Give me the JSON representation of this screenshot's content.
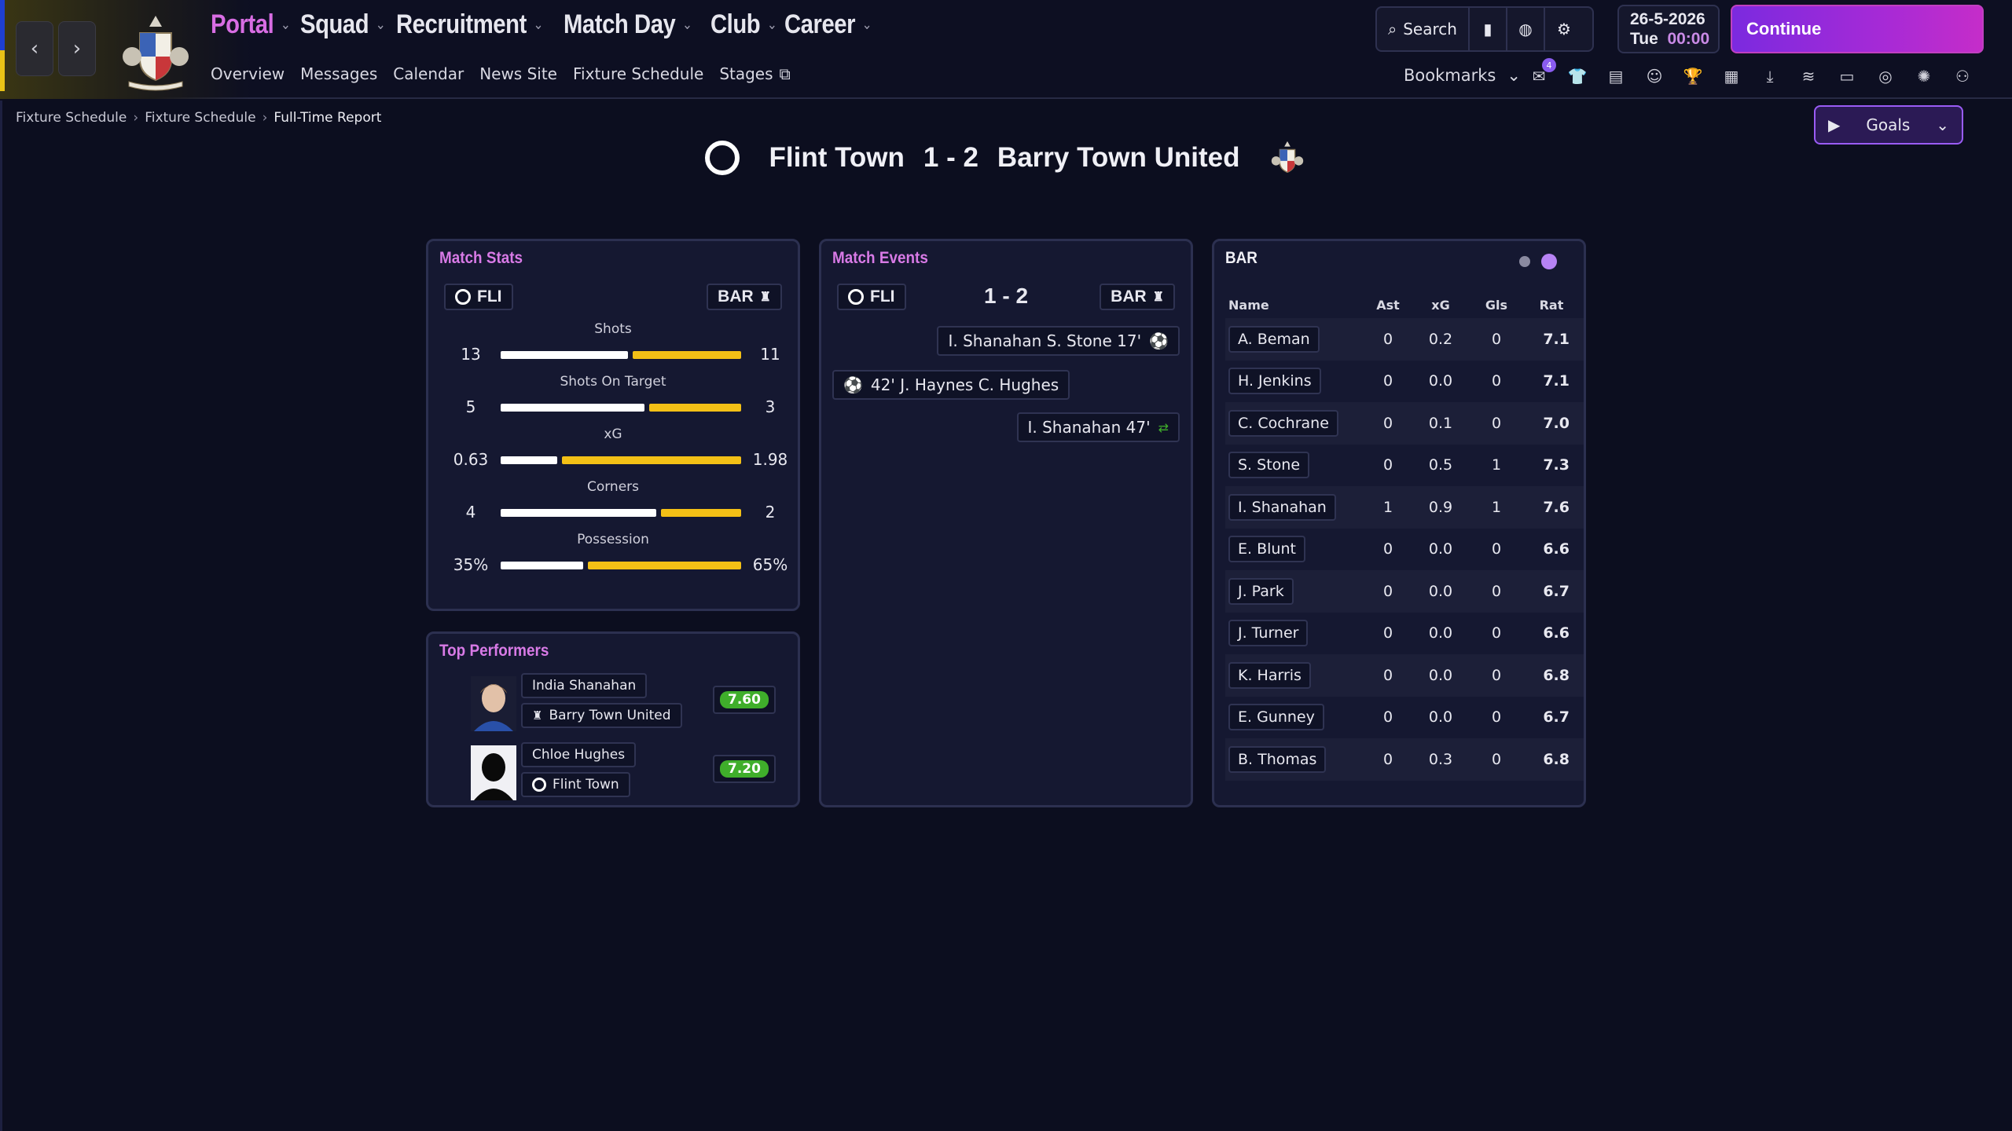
{
  "nav": {
    "back_label": "‹",
    "forward_label": "›",
    "main": [
      {
        "label": "Portal",
        "active": true
      },
      {
        "label": "Squad",
        "active": false
      },
      {
        "label": "Recruitment",
        "active": false
      },
      {
        "label": "Match Day",
        "active": false
      },
      {
        "label": "Club",
        "active": false
      },
      {
        "label": "Career",
        "active": false
      }
    ],
    "sub": [
      "Overview",
      "Messages",
      "Calendar",
      "News Site",
      "Fixture Schedule",
      "Stages"
    ],
    "search_label": "Search",
    "date": "26-5-2026",
    "day": "Tue",
    "time": "00:00",
    "continue_label": "Continue",
    "bookmarks_label": "Bookmarks",
    "inbox_badge": "4"
  },
  "breadcrumb": [
    "Fixture Schedule",
    "Fixture Schedule",
    "Full-Time Report"
  ],
  "goals_button": "Goals",
  "match": {
    "home": "Flint Town",
    "away": "Barry Town United",
    "score": "1 - 2",
    "home_abbr": "FLI",
    "away_abbr": "BAR"
  },
  "match_stats": {
    "title": "Match Stats",
    "rows": [
      {
        "label": "Shots",
        "home": "13",
        "away": "11",
        "home_share": 0.54
      },
      {
        "label": "Shots On Target",
        "home": "5",
        "away": "3",
        "home_share": 0.61
      },
      {
        "label": "xG",
        "home": "0.63",
        "away": "1.98",
        "home_share": 0.24
      },
      {
        "label": "Corners",
        "home": "4",
        "away": "2",
        "home_share": 0.66
      },
      {
        "label": "Possession",
        "home": "35%",
        "away": "65%",
        "home_share": 0.35
      }
    ]
  },
  "top_performers": {
    "title": "Top Performers",
    "players": [
      {
        "name": "India Shanahan",
        "team": "Barry Town United",
        "rating": "7.60"
      },
      {
        "name": "Chloe Hughes",
        "team": "Flint Town",
        "rating": "7.20"
      }
    ]
  },
  "match_events": {
    "title": "Match Events",
    "score": "1 - 2",
    "events": [
      {
        "text": "I. Shanahan  S. Stone 17'",
        "side": "away",
        "type": "goal"
      },
      {
        "text": "42'  J. Haynes  C. Hughes",
        "side": "home",
        "type": "goal"
      },
      {
        "text": "I. Shanahan 47'",
        "side": "away",
        "type": "substitution"
      }
    ]
  },
  "player_table": {
    "title": "BAR",
    "columns": [
      "Name",
      "Ast",
      "xG",
      "Gls",
      "Rat"
    ],
    "rows": [
      [
        "A. Beman",
        "0",
        "0.2",
        "0",
        "7.1"
      ],
      [
        "H. Jenkins",
        "0",
        "0.0",
        "0",
        "7.1"
      ],
      [
        "C. Cochrane",
        "0",
        "0.1",
        "0",
        "7.0"
      ],
      [
        "S. Stone",
        "0",
        "0.5",
        "1",
        "7.3"
      ],
      [
        "I. Shanahan",
        "1",
        "0.9",
        "1",
        "7.6"
      ],
      [
        "E. Blunt",
        "0",
        "0.0",
        "0",
        "6.6"
      ],
      [
        "J. Park",
        "0",
        "0.0",
        "0",
        "6.7"
      ],
      [
        "J. Turner",
        "0",
        "0.0",
        "0",
        "6.6"
      ],
      [
        "K. Harris",
        "0",
        "0.0",
        "0",
        "6.8"
      ],
      [
        "E. Gunney",
        "0",
        "0.0",
        "0",
        "6.7"
      ],
      [
        "B. Thomas",
        "0",
        "0.3",
        "0",
        "6.8"
      ]
    ]
  },
  "colors": {
    "accent": "#d86de3",
    "home_bar": "#ffffff",
    "away_bar": "#f3c016",
    "rating_good": "#3fae2b"
  }
}
